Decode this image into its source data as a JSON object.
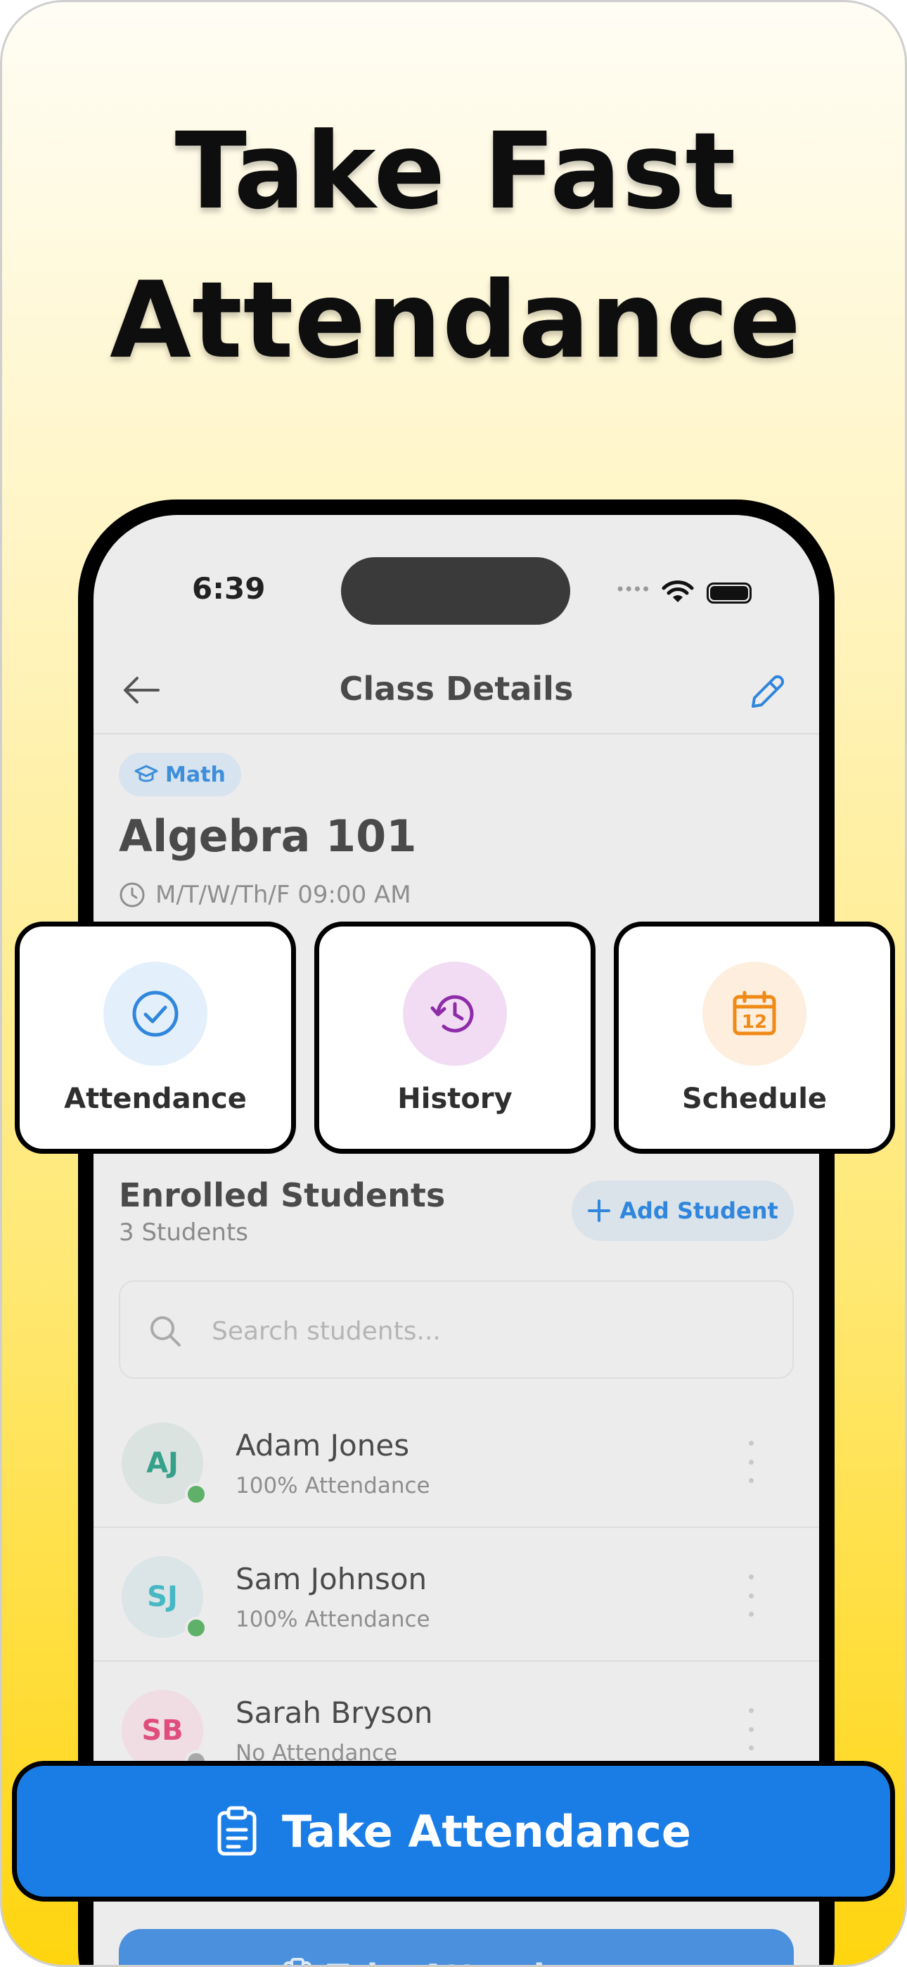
{
  "promo": {
    "headline_line1": "Take Fast",
    "headline_line2": "Attendance",
    "bg_top": "#fffdf5",
    "bg_bottom": "#ffd50f"
  },
  "status_bar": {
    "time": "6:39",
    "signal_dots": "••••"
  },
  "navbar": {
    "title": "Class Details",
    "back_icon": "arrow-left-icon",
    "edit_icon": "pencil-icon"
  },
  "class_info": {
    "subject": "Math",
    "subject_icon": "graduation-cap-icon",
    "name": "Algebra 101",
    "schedule": "M/T/W/Th/F 09:00 AM",
    "schedule_icon": "clock-icon"
  },
  "actions": [
    {
      "label": "Attendance",
      "icon": "check-circle-icon",
      "color": "#2f86dc",
      "bg": "#e3effb"
    },
    {
      "label": "History",
      "icon": "history-icon",
      "color": "#8e2ca8",
      "bg": "#f1dcf4"
    },
    {
      "label": "Schedule",
      "icon": "calendar-icon",
      "color": "#f08a16",
      "bg": "#fdeedd",
      "calendar_day": "12"
    }
  ],
  "students_section": {
    "title": "Enrolled Students",
    "count": "3 Students",
    "add_button": "Add Student",
    "search_placeholder": "Search students..."
  },
  "students": [
    {
      "initials": "AJ",
      "name": "Adam Jones",
      "attendance": "100% Attendance",
      "initials_color": "#36a08a",
      "avatar_bg": "#dae3e0",
      "status_color": "#5fb069"
    },
    {
      "initials": "SJ",
      "name": "Sam Johnson",
      "attendance": "100% Attendance",
      "initials_color": "#45b8c4",
      "avatar_bg": "#dbe4e6",
      "status_color": "#5fb069"
    },
    {
      "initials": "SB",
      "name": "Sarah Bryson",
      "attendance": "No Attendance",
      "initials_color": "#e04d7d",
      "avatar_bg": "#efdde3",
      "status_color": "#a8a8a8"
    }
  ],
  "cta": {
    "label": "Take Attendance",
    "icon": "clipboard-icon",
    "color": "#1a7de6"
  }
}
